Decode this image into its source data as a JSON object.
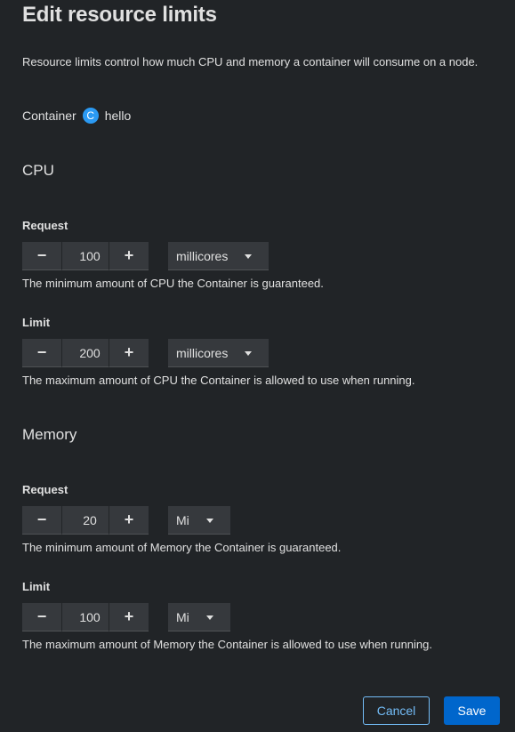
{
  "modal": {
    "title": "Edit resource limits",
    "description": "Resource limits control how much CPU and memory a container will consume on a node."
  },
  "container": {
    "label": "Container",
    "badge": "C",
    "name": "hello",
    "badge_color": "#2b9af3"
  },
  "cpu": {
    "section_title": "CPU",
    "request": {
      "label": "Request",
      "value": "100",
      "unit": "millicores",
      "helper": "The minimum amount of CPU the Container is guaranteed."
    },
    "limit": {
      "label": "Limit",
      "value": "200",
      "unit": "millicores",
      "helper": "The maximum amount of CPU the Container is allowed to use when running."
    }
  },
  "memory": {
    "section_title": "Memory",
    "request": {
      "label": "Request",
      "value": "20",
      "unit": "Mi",
      "helper": "The minimum amount of Memory the Container is guaranteed."
    },
    "limit": {
      "label": "Limit",
      "value": "100",
      "unit": "Mi",
      "helper": "The maximum amount of Memory the Container is allowed to use when running."
    }
  },
  "stepper": {
    "minus": "−",
    "plus": "+"
  },
  "footer": {
    "cancel_label": "Cancel",
    "save_label": "Save"
  },
  "colors": {
    "background": "#212427",
    "control": "#36393d",
    "primary": "#0066cc",
    "link": "#73bcf7"
  }
}
